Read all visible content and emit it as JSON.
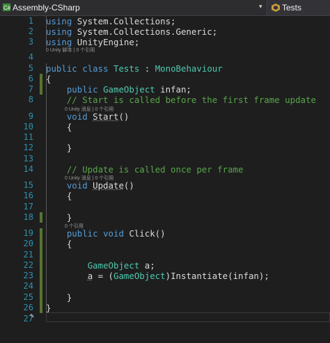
{
  "toolbar": {
    "project": "Assembly-CSharp",
    "member": "Tests"
  },
  "gutter": [
    "1",
    "2",
    "3",
    "4",
    "5",
    "6",
    "7",
    "8",
    "9",
    "10",
    "11",
    "12",
    "13",
    "14",
    "15",
    "16",
    "17",
    "18",
    "19",
    "20",
    "21",
    "22",
    "23",
    "24",
    "25",
    "26",
    "27"
  ],
  "lens": {
    "class": "0 Unity 脚本 | 0 个引用",
    "start": "0 Unity 消息 | 0 个引用",
    "update": "0 Unity 消息 | 0 个引用",
    "click": "0 个引用"
  },
  "code": {
    "l1a": "using",
    "l1b": " System.Collections;",
    "l2a": "using",
    "l2b": " System.Collections.Generic;",
    "l3a": "using",
    "l3b": " UnityEngine;",
    "l5a": "public",
    "l5b": " ",
    "l5c": "class",
    "l5d": " ",
    "l5e": "Tests",
    "l5f": " : ",
    "l5g": "MonoBehaviour",
    "l6": "{",
    "l7a": "    public ",
    "l7b": "GameObject",
    "l7c": " infan;",
    "l8": "    // Start is called before the first frame update",
    "l9a": "    void ",
    "l9b": "Start",
    "l9c": "()",
    "l10": "    {",
    "l12": "    }",
    "l14": "    // Update is called once per frame",
    "l15a": "    void ",
    "l15b": "Update",
    "l15c": "()",
    "l16": "    {",
    "l18": "    }",
    "l19a": "    public ",
    "l19b": "void",
    "l19c": " Click()",
    "l20": "    {",
    "l22a": "        ",
    "l22b": "GameObject",
    "l22c": " a;",
    "l23a": "        ",
    "l23b": "a",
    "l23c": " = (",
    "l23d": "GameObject",
    "l23e": ")Instantiate(infan);",
    "l25": "    }",
    "l26": "}"
  },
  "colors": {
    "background": "#1e1e1e",
    "keyword": "#569cd6",
    "type": "#4ec9b0",
    "comment": "#57a64a",
    "line_number": "#2b91af"
  }
}
